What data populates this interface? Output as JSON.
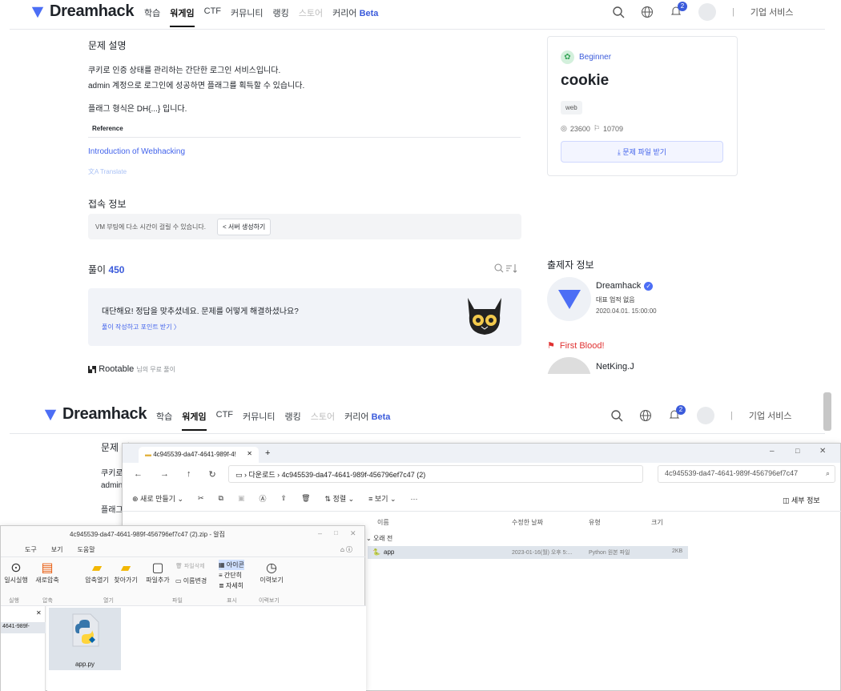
{
  "nav": {
    "logo": "Dreamhack",
    "items": [
      "학습",
      "워게임",
      "CTF",
      "커뮤니티",
      "랭킹",
      "스토어",
      "커리어"
    ],
    "beta": "Beta",
    "notif_count": "2",
    "separator": "|",
    "enterprise": "기업 서비스"
  },
  "problem": {
    "section_title": "문제 설명",
    "line1": "쿠키로 인증 상태를 관리하는 간단한 로그인 서비스입니다.",
    "line2": "admin 계정으로 로그인에 성공하면 플래그를 획득할 수 있습니다.",
    "line3": "플래그 형식은 DH{...} 입니다.",
    "reference_label": "Reference",
    "reference_link": "Introduction of Webhacking",
    "translate": "Translate"
  },
  "access": {
    "title": "접속 정보",
    "notice": "VM 부팅에 다소 시간이 걸릴 수 있습니다.",
    "button": "서버 생성하기"
  },
  "solutions": {
    "title": "풀이",
    "count": "450",
    "congrats": "대단해요! 정답을 맞추셨네요. 문제를 어떻게 해결하셨나요?",
    "write_link": "풀이 작성하고 포인트 받기 〉",
    "rootable": "Rootable",
    "rootable_sub": "님의 무료 풀이"
  },
  "card": {
    "level": "Beginner",
    "title": "cookie",
    "tag": "web",
    "views": "23600",
    "solves": "10709",
    "download": "문제 파일 받기"
  },
  "author": {
    "title": "출제자 정보",
    "name": "Dreamhack",
    "sub": "대표 업적 없음",
    "date": "2020.04.01. 15:00:00",
    "first_blood": "First Blood!",
    "fb_name": "NetKing.J"
  },
  "bottom": {
    "problem_title_partial": "문제 설",
    "line_partial_1": "쿠키로",
    "line_partial_2": "admin",
    "line_partial_3": "플래그"
  },
  "explorer": {
    "tab_title": "4c945539-da47-4641-989f-4!",
    "new_tab": "+",
    "breadcrumb_root": "다운로드",
    "breadcrumb_folder": "4c945539-da47-4641-989f-456796ef7c47 (2)",
    "search_placeholder": "4c945539-da47-4641-989f-456796ef7c47",
    "new_label": "새로 만들기",
    "sort_label": "정렬",
    "view_label": "보기",
    "more": "···",
    "details_label": "세부 정보",
    "col_name": "이름",
    "col_date": "수정한 날짜",
    "col_type": "유형",
    "col_size": "크기",
    "group": "오래 전",
    "file_name": "app",
    "file_date": "2023-01-16(월) 오후 5:...",
    "file_type": "Python 원본 파일",
    "file_size": "2KB"
  },
  "alzip": {
    "title": "4c945539-da47-4641-989f-456796ef7c47 (2).zip - 알집",
    "menu": [
      "도구",
      "보기",
      "도움말"
    ],
    "btn_run": "일시실행",
    "btn_new": "새로압축",
    "btn_open": "압축열기",
    "btn_find": "찾아가기",
    "btn_add": "파일추가",
    "btn_delete": "파일삭제",
    "btn_rename": "이름변경",
    "view_icon": "아이콘",
    "view_simple": "간단히",
    "view_detail": "자세히",
    "btn_history": "이력보기",
    "group_exec": "실행",
    "group_zip": "압축",
    "group_open": "열기",
    "group_file": "파일",
    "group_view": "표시",
    "group_hist": "이력보기",
    "tree_item": "4641-989f-",
    "file": "app.py"
  }
}
